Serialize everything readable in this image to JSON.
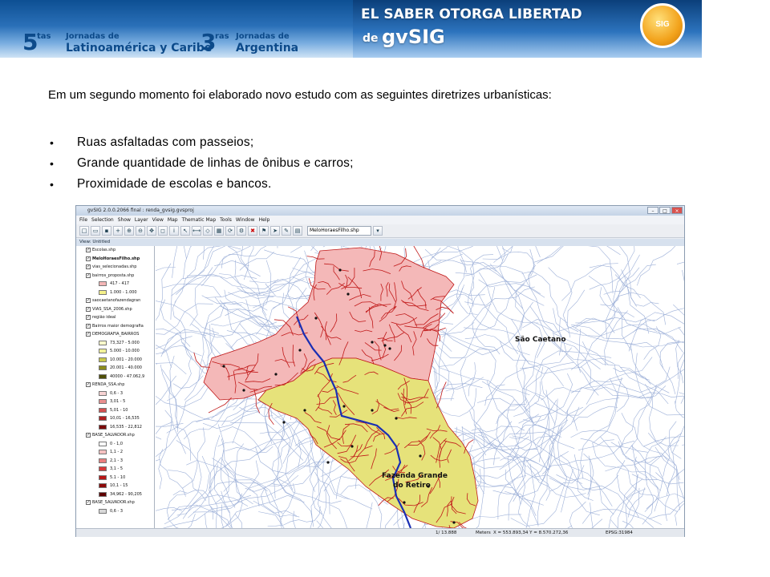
{
  "banner": {
    "num1": "5",
    "tas": "tas",
    "jornadas1": "Jornadas de",
    "region1": "Latinoamérica y Caribe",
    "num2": "3",
    "ras": "ras",
    "jornadas2": "Jornadas de",
    "region2": "Argentina",
    "slogan": "EL SABER OTORGA LIBERTAD",
    "de": "de",
    "brand": "gvSIG",
    "logo_text": "SIG"
  },
  "intro": "Em um segundo momento foi elaborado novo estudo com as seguintes diretrizes urbanísticas:",
  "bullets": [
    "Ruas asfaltadas com passeios;",
    "Grande quantidade de linhas de ônibus e carros;",
    "Proximidade de escolas e bancos."
  ],
  "app": {
    "title": "gvSIG 2.0.0.2066 final : renda_gvsig.gvsproj",
    "menu": [
      "File",
      "Selection",
      "Show",
      "Layer",
      "View",
      "Map",
      "Thematic Map",
      "Tools",
      "Window",
      "Help"
    ],
    "toolbar_select": "MeloHoraesFilho.shp",
    "view_title": "View: Untitled",
    "toc": [
      {
        "label": "Escolas.shp",
        "type": "layer",
        "checked": true
      },
      {
        "label": "MeloHoraesFilho.shp",
        "type": "layer",
        "checked": true,
        "bold": true
      },
      {
        "label": "vias_selecionadas.shp",
        "type": "layer",
        "checked": true
      },
      {
        "label": "bairros_proposta.shp",
        "type": "layer",
        "checked": true
      },
      {
        "label": "417 - 417",
        "type": "legend",
        "color": "#f4b6b6"
      },
      {
        "label": "1.000 - 1.000",
        "type": "legend",
        "color": "#f4f08a"
      },
      {
        "label": "saocaetanofazendagran",
        "type": "layer",
        "checked": true
      },
      {
        "label": "VIAS_SSA_2006.shp",
        "type": "layer",
        "checked": true
      },
      {
        "label": "região ideal",
        "type": "layer",
        "checked": true
      },
      {
        "label": "Bairros maior demografia",
        "type": "layer",
        "checked": true
      },
      {
        "label": "DEMOGRAFIA_BAIRROS",
        "type": "layer",
        "checked": true
      },
      {
        "label": "73,327 - 5.000",
        "type": "legend",
        "color": "#ffffcc"
      },
      {
        "label": "5.000 - 10.000",
        "type": "legend",
        "color": "#f2f29a"
      },
      {
        "label": "10.001 - 20.000",
        "type": "legend",
        "color": "#c9c94a"
      },
      {
        "label": "20.001 - 40.000",
        "type": "legend",
        "color": "#8c8c1c"
      },
      {
        "label": "40000 - 47.062,9",
        "type": "legend",
        "color": "#4e4e08"
      },
      {
        "label": "RENDA_SSA.shp",
        "type": "layer",
        "checked": true
      },
      {
        "label": "0,6 - 3",
        "type": "legend",
        "color": "#f7d3d3"
      },
      {
        "label": "3,01 - 5",
        "type": "legend",
        "color": "#e98f8f"
      },
      {
        "label": "5,01 - 10",
        "type": "legend",
        "color": "#d35050"
      },
      {
        "label": "10,01 - 16,535",
        "type": "legend",
        "color": "#b01f1f"
      },
      {
        "label": "16,535 - 22,812",
        "type": "legend",
        "color": "#7a0a0a"
      },
      {
        "label": "BASE_SALVADOR.shp",
        "type": "layer",
        "checked": true
      },
      {
        "label": "0 - 1,0",
        "type": "legend",
        "color": "#ffffff"
      },
      {
        "label": "1,1 - 2",
        "type": "legend",
        "color": "#f5c1c1"
      },
      {
        "label": "2,1 - 3",
        "type": "legend",
        "color": "#ea7f7f"
      },
      {
        "label": "3,1 - 5",
        "type": "legend",
        "color": "#d93a3a"
      },
      {
        "label": "5.1 - 10",
        "type": "legend",
        "color": "#b81616"
      },
      {
        "label": "10,1 - 15",
        "type": "legend",
        "color": "#8e0a0a"
      },
      {
        "label": "34,962 - 90,205",
        "type": "legend",
        "color": "#5e0000"
      },
      {
        "label": "BASE_SALVADOR.shp",
        "type": "layer",
        "checked": true
      },
      {
        "label": "0,6 - 3",
        "type": "legend",
        "color": "#d8d8d8"
      }
    ],
    "map_labels": {
      "region1": "São Caetano",
      "region2_line1": "Fazenda Grande",
      "region2_line2": "do Retiro"
    },
    "status": {
      "scale": "1/ 13.888",
      "units": "Meters",
      "coords": "X = 553.893,34  Y = 8.570.272,36",
      "epsg": "EPSG:31984"
    },
    "colors": {
      "region1_fill": "#f4b8b8",
      "region2_fill": "#e6e27a",
      "street_blue": "#9db0d8",
      "street_red": "#c01818",
      "route": "#1a2fb3"
    }
  }
}
